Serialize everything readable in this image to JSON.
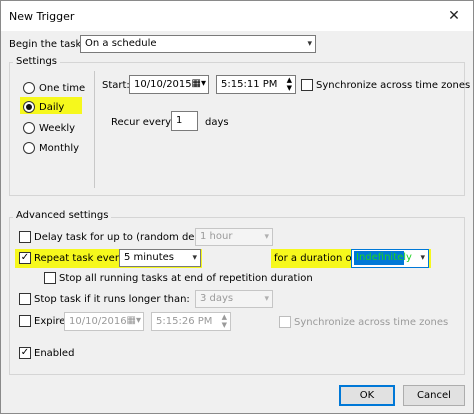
{
  "window": {
    "title": "New Trigger",
    "close_glyph": "✕"
  },
  "begin": {
    "label": "Begin the task:",
    "value": "On a schedule"
  },
  "settings": {
    "title": "Settings",
    "radios": [
      "One time",
      "Daily",
      "Weekly",
      "Monthly"
    ],
    "selected": "Daily",
    "start_label": "Start:",
    "start_date": "10/10/2015",
    "start_time": "5:15:11 PM",
    "sync_label": "Synchronize across time zones",
    "recur_label": "Recur every:",
    "recur_value": "1",
    "recur_unit": "days"
  },
  "advanced": {
    "title": "Advanced settings",
    "delay_label": "Delay task for up to (random delay):",
    "delay_value": "1 hour",
    "repeat_label": "Repeat task every:",
    "repeat_value": "5 minutes",
    "duration_label": "for a duration of:",
    "duration_value": "Indefinitely",
    "stop_running_label": "Stop all running tasks at end of repetition duration",
    "stop_longer_label": "Stop task if it runs longer than:",
    "stop_longer_value": "3 days",
    "expire_label": "Expire:",
    "expire_date": "10/10/2016",
    "expire_time": "5:15:26 PM",
    "expire_sync_label": "Synchronize across time zones",
    "enabled_label": "Enabled"
  },
  "buttons": {
    "ok": "OK",
    "cancel": "Cancel"
  },
  "colors": {
    "highlight": "#f6f81c",
    "selection": "#0078d7",
    "duration_text": "#1fd11f"
  },
  "icons": {
    "dropdown": "chevron-down-icon",
    "calendar": "calendar-icon",
    "spinner": "spinner-icon",
    "checkmark": "checkmark-icon"
  }
}
